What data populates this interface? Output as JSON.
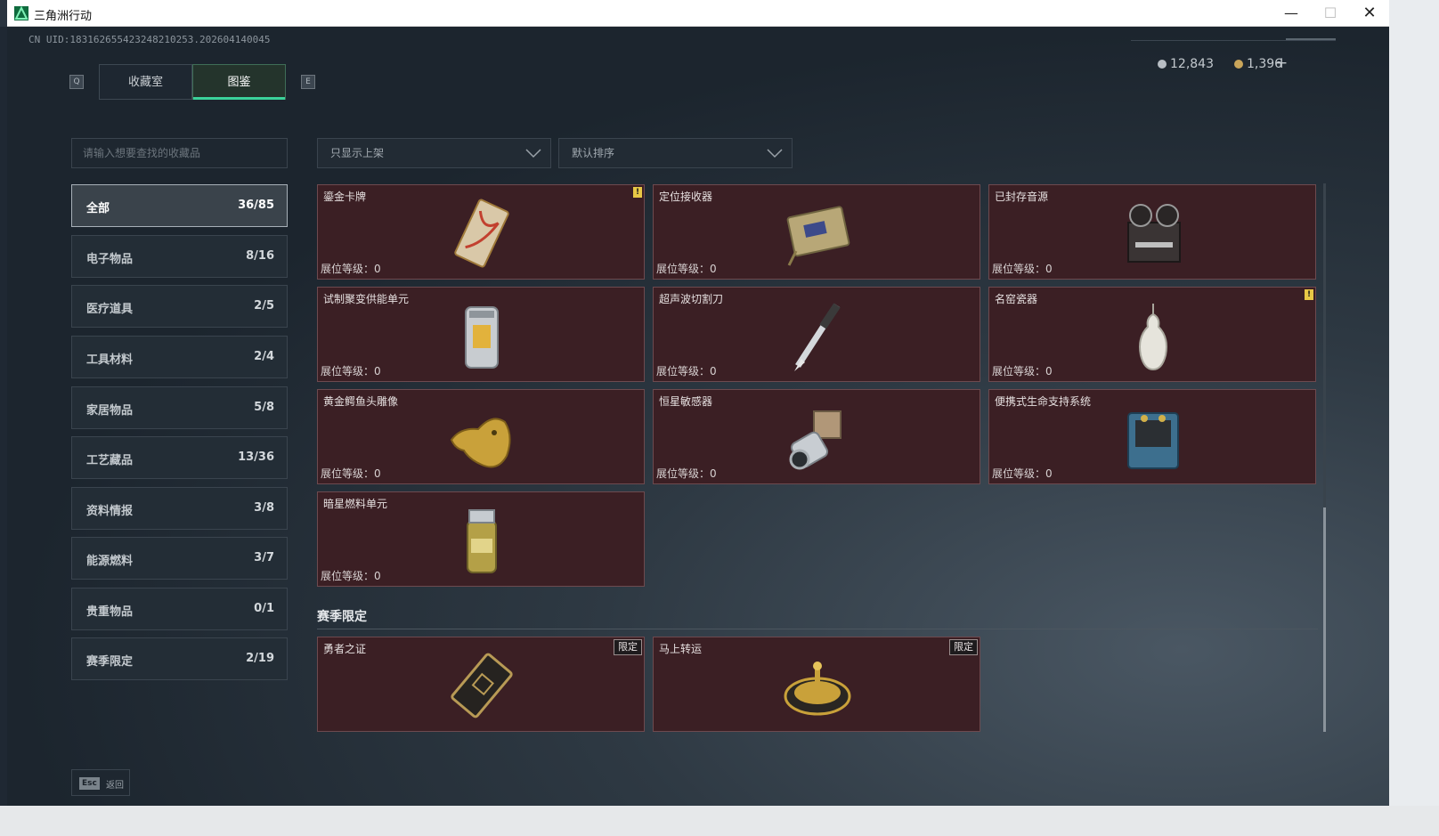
{
  "window": {
    "title": "三角洲行动"
  },
  "header": {
    "uid": "CN UID:1831626554232482102​53.202604140045",
    "tab_key_left": "Q",
    "tab_key_right": "E",
    "tabs": [
      {
        "label": "收藏室"
      },
      {
        "label": "图鉴"
      }
    ],
    "currency": [
      {
        "value": "12,843",
        "icon": "silver-coin-icon"
      },
      {
        "value": "1,396",
        "icon": "gold-coin-icon"
      }
    ],
    "add_label": "+"
  },
  "search": {
    "placeholder": "请输入想要查找的收藏品"
  },
  "categories": [
    {
      "label": "全部",
      "count": "36/85",
      "active": true
    },
    {
      "label": "电子物品",
      "count": "8/16"
    },
    {
      "label": "医疗道具",
      "count": "2/5"
    },
    {
      "label": "工具材料",
      "count": "2/4"
    },
    {
      "label": "家居物品",
      "count": "5/8"
    },
    {
      "label": "工艺藏品",
      "count": "13/36"
    },
    {
      "label": "资料情报",
      "count": "3/8"
    },
    {
      "label": "能源燃料",
      "count": "3/7"
    },
    {
      "label": "贵重物品",
      "count": "0/1"
    },
    {
      "label": "赛季限定",
      "count": "2/19"
    }
  ],
  "filters": {
    "display": "只显示上架",
    "sort": "默认排序"
  },
  "items": [
    {
      "name": "鎏金卡牌",
      "level": "展位等级：0",
      "notice": "!"
    },
    {
      "name": "定位接收器",
      "level": "展位等级：0"
    },
    {
      "name": "已封存音源",
      "level": "展位等级：0"
    },
    {
      "name": "试制聚变供能单元",
      "level": "展位等级：0"
    },
    {
      "name": "超声波切割刀",
      "level": "展位等级：0"
    },
    {
      "name": "名窑瓷器",
      "level": "展位等级：0",
      "notice": "!"
    },
    {
      "name": "黄金鳄鱼头雕像",
      "level": "展位等级：0"
    },
    {
      "name": "恒星敏感器",
      "level": "展位等级：0"
    },
    {
      "name": "便携式生命支持系统",
      "level": "展位等级：0"
    },
    {
      "name": "暗星燃料单元",
      "level": "展位等级：0"
    }
  ],
  "season": {
    "title": "赛季限定",
    "items": [
      {
        "name": "勇者之证",
        "tag": "限定"
      },
      {
        "name": "马上转运",
        "tag": "限定"
      }
    ]
  },
  "footer": {
    "esc_key": "Esc",
    "esc_label": "返回"
  },
  "colors": {
    "accent": "#3bd29a",
    "card_bg": "#3b1f24",
    "notice": "#e8c846"
  }
}
